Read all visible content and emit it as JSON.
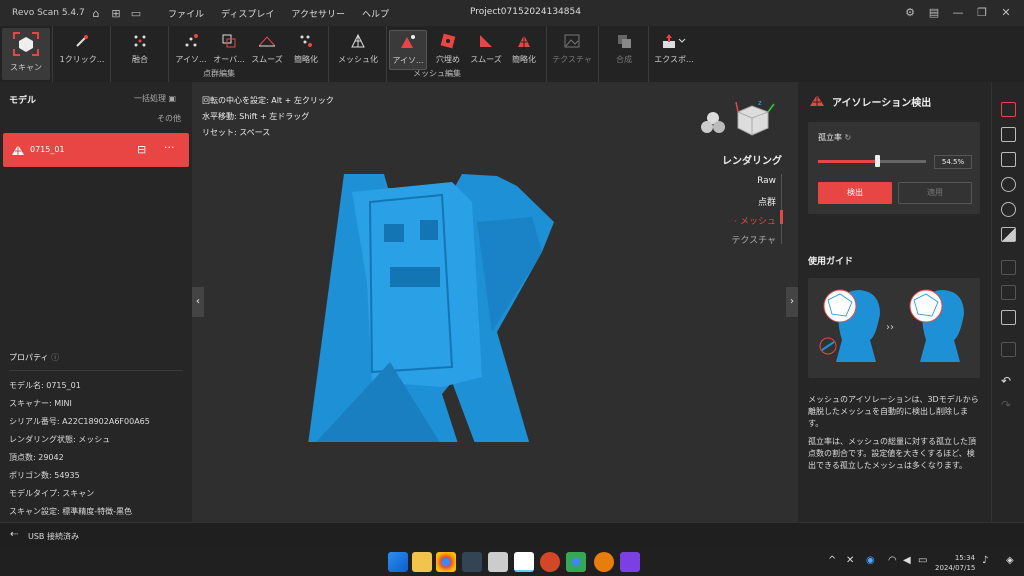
{
  "titlebar": {
    "app_name": "Revo Scan 5.4.7",
    "menu": [
      "ファイル",
      "ディスプレイ",
      "アクセサリー",
      "ヘルプ"
    ],
    "project": "Project07152024134854"
  },
  "toolbar": {
    "scan": "スキャン",
    "one_click": "1クリック...",
    "fusion": "融合",
    "pc_tools": [
      "アイソ...",
      "オーバ...",
      "スムーズ",
      "簡略化"
    ],
    "mesh": "メッシュ化",
    "mesh_tools": [
      "アイソ...",
      "穴埋め",
      "スムーズ",
      "簡略化"
    ],
    "texture": "テクスチャ",
    "merge": "合成",
    "export": "エクスポ...",
    "group_pc": "点群編集",
    "group_mesh": "メッシュ編集"
  },
  "left": {
    "title": "モデル",
    "batch": "一括処理",
    "other": "その他",
    "model_name": "0715_01",
    "props_title": "プロパティ",
    "props": [
      {
        "label": "モデル名:",
        "value": "0715_01"
      },
      {
        "label": "スキャナー:",
        "value": "MINI"
      },
      {
        "label": "シリアル番号:",
        "value": "A22C18902A6F00A65"
      },
      {
        "label": "レンダリング状態:",
        "value": "メッシュ"
      },
      {
        "label": "頂点数:",
        "value": "29042"
      },
      {
        "label": "ポリゴン数:",
        "value": "54935"
      },
      {
        "label": "モデルタイプ:",
        "value": "スキャン"
      },
      {
        "label": "スキャン設定:",
        "value": "標準精度-特徴-黒色"
      }
    ]
  },
  "center": {
    "hints": [
      "回転の中心を設定: Alt + 左クリック",
      "水平移動: Shift + 左ドラッグ",
      "リセット: スペース"
    ],
    "render_title": "レンダリング",
    "modes": [
      "Raw",
      "点群",
      "メッシュ",
      "テクスチャ"
    ],
    "active_mode": "メッシュ",
    "mesh_color": "#1e90d6"
  },
  "right": {
    "title": "アイソレーション検出",
    "ratio_label": "孤立率",
    "ratio_value": "54.5%",
    "ratio": 0.545,
    "detect": "検出",
    "apply": "適用",
    "guide_title": "使用ガイド",
    "desc1": "メッシュのアイソレーションは、3Dモデルから離脱したメッシュを自動的に検出し削除します。",
    "desc2": "孤立率は、メッシュの総量に対する孤立した頂点数の割合です。設定値を大きくするほど、検出できる孤立したメッシュは多くなります。",
    "accent": "#e84545"
  },
  "status": {
    "usb": "USB 接続済み"
  },
  "taskbar": {
    "time": "15:34",
    "date": "2024/07/15"
  }
}
